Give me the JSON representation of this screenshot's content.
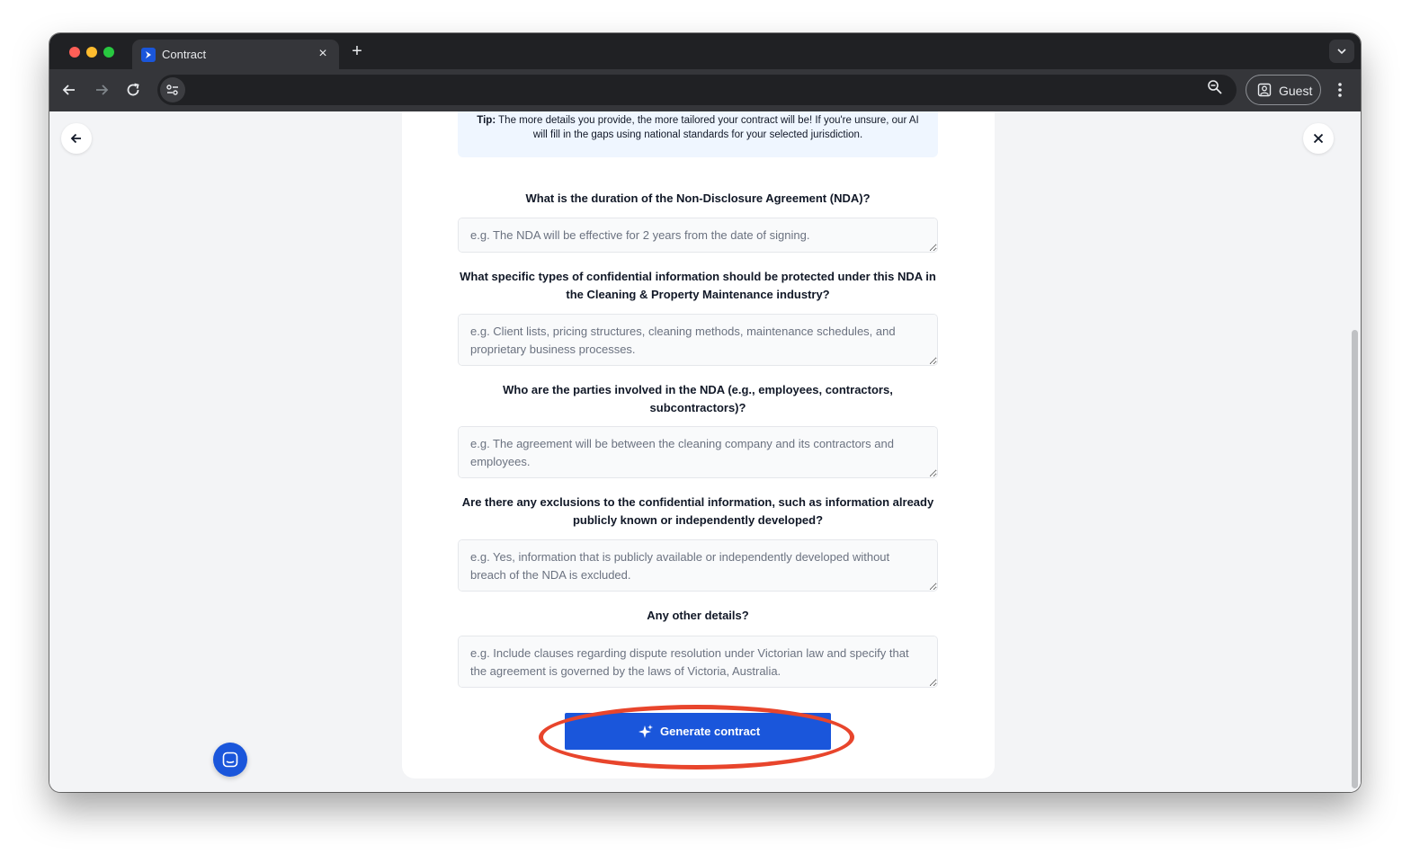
{
  "browser": {
    "tab_title": "Contract",
    "tab_close_glyph": "×",
    "new_tab_glyph": "+",
    "address_value": "",
    "profile_label": "Guest",
    "icons": [
      "back-arrow-icon",
      "forward-arrow-icon",
      "reload-icon",
      "site-settings-icon",
      "zoom-icon",
      "profile-icon",
      "more-vert-icon",
      "chevron-down-icon"
    ]
  },
  "page": {
    "tip_label": "Tip:",
    "tip_text": " The more details you provide, the more tailored your contract will be! If you're unsure, our AI will fill in the gaps using national standards for your selected jurisdiction.",
    "questions": [
      {
        "question": "What is the duration of the Non-Disclosure Agreement (NDA)?",
        "placeholder": "e.g. The NDA will be effective for 2 years from the date of signing."
      },
      {
        "question": "What specific types of confidential information should be protected under this NDA in the Cleaning & Property Maintenance industry?",
        "placeholder": "e.g. Client lists, pricing structures, cleaning methods, maintenance schedules, and proprietary business processes."
      },
      {
        "question": "Who are the parties involved in the NDA (e.g., employees, contractors, subcontractors)?",
        "placeholder": "e.g. The agreement will be between the cleaning company and its contractors and employees."
      },
      {
        "question": "Are there any exclusions to the confidential information, such as information already publicly known or independently developed?",
        "placeholder": "e.g. Yes, information that is publicly available or independently developed without breach of the NDA is excluded."
      },
      {
        "question": "Any other details?",
        "placeholder": "e.g. Include clauses regarding dispute resolution under Victorian law and specify that the agreement is governed by the laws of Victoria, Australia."
      }
    ],
    "generate_label": "Generate contract"
  },
  "colors": {
    "brand_blue": "#1a56db",
    "tip_background": "#eff6ff",
    "highlight_red": "#e8452c"
  }
}
